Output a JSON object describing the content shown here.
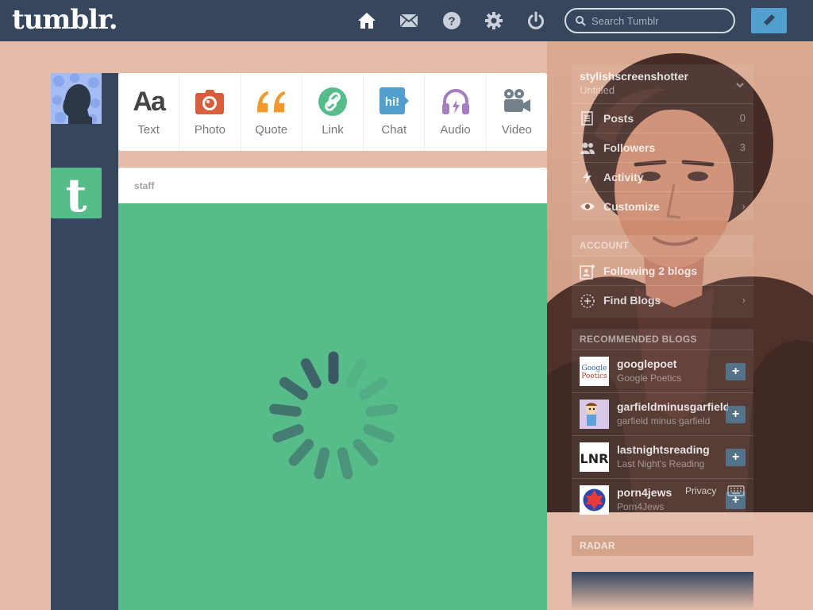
{
  "topbar": {
    "logo": "tumblr.",
    "nav": [
      {
        "icon": "home-icon"
      },
      {
        "icon": "mail-icon"
      },
      {
        "icon": "help-icon"
      },
      {
        "icon": "gear-icon"
      },
      {
        "icon": "power-icon"
      }
    ],
    "search_placeholder": "Search Tumblr",
    "compose_icon": "pencil-icon"
  },
  "post_types": [
    {
      "label": "Text",
      "icon": "text-icon",
      "color": "#444444"
    },
    {
      "label": "Photo",
      "icon": "camera-icon",
      "color": "#d95e40"
    },
    {
      "label": "Quote",
      "icon": "quote-icon",
      "color": "#f2992e"
    },
    {
      "label": "Link",
      "icon": "link-icon",
      "color": "#56bc8a"
    },
    {
      "label": "Chat",
      "icon": "chat-icon",
      "color": "#529ecc"
    },
    {
      "label": "Audio",
      "icon": "headphones-icon",
      "color": "#a77dc2"
    },
    {
      "label": "Video",
      "icon": "video-camera-icon",
      "color": "#748089"
    }
  ],
  "post": {
    "author": "staff",
    "status": "loading"
  },
  "sidebar": {
    "blog_name": "stylishscreenshotter",
    "blog_title": "Untitled",
    "items": [
      {
        "label": "Posts",
        "count": "0",
        "icon": "posts-icon"
      },
      {
        "label": "Followers",
        "count": "3",
        "icon": "followers-icon"
      },
      {
        "label": "Activity",
        "count": "",
        "icon": "activity-icon"
      },
      {
        "label": "Customize",
        "count": "›",
        "icon": "eye-icon"
      }
    ],
    "account_header": "ACCOUNT",
    "account_items": [
      {
        "label": "Following 2 blogs",
        "icon": "following-icon"
      },
      {
        "label": "Find Blogs",
        "icon": "find-blogs-icon",
        "count": "›"
      }
    ],
    "recommended_header": "RECOMMENDED BLOGS",
    "recommended": [
      {
        "name": "googlepoet",
        "desc": "Google Poetics",
        "avatar": "google-poetics-logo"
      },
      {
        "name": "garfieldminusgarfield",
        "desc": "garfield minus garfield",
        "avatar": "garfield-avatar"
      },
      {
        "name": "lastnightsreading",
        "desc": "Last Night's Reading",
        "avatar": "lnr-logo"
      },
      {
        "name": "porn4jews",
        "desc": "Porn4Jews",
        "avatar": "star-avatar"
      }
    ],
    "footer_privacy": "Privacy",
    "radar_header": "RADAR"
  },
  "colors": {
    "topbar": "#36465d",
    "background": "#e4bca9",
    "accent_blue": "#529ecc",
    "post_green": "#56bc8a"
  }
}
